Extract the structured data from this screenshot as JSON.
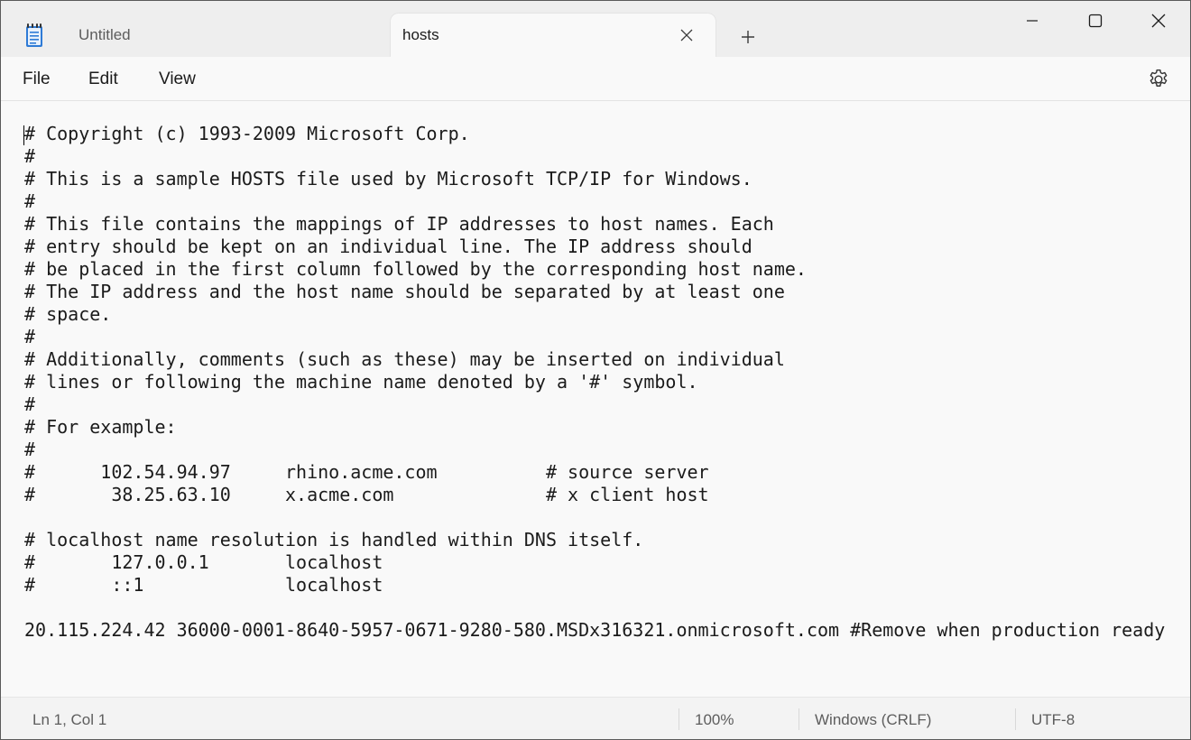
{
  "tabs": [
    {
      "label": "Untitled",
      "active": false
    },
    {
      "label": "hosts",
      "active": true
    }
  ],
  "icons": {
    "app": "notepad-icon",
    "tab_close": "close-icon",
    "new_tab": "plus-icon",
    "minimize": "minimize-icon",
    "maximize": "maximize-icon",
    "close": "close-icon",
    "settings": "gear-icon"
  },
  "menu": {
    "file": "File",
    "edit": "Edit",
    "view": "View"
  },
  "editor": {
    "content": "# Copyright (c) 1993-2009 Microsoft Corp.\n#\n# This is a sample HOSTS file used by Microsoft TCP/IP for Windows.\n#\n# This file contains the mappings of IP addresses to host names. Each\n# entry should be kept on an individual line. The IP address should\n# be placed in the first column followed by the corresponding host name.\n# The IP address and the host name should be separated by at least one\n# space.\n#\n# Additionally, comments (such as these) may be inserted on individual\n# lines or following the machine name denoted by a '#' symbol.\n#\n# For example:\n#\n#      102.54.94.97     rhino.acme.com          # source server\n#       38.25.63.10     x.acme.com              # x client host\n\n# localhost name resolution is handled within DNS itself.\n#       127.0.0.1       localhost\n#       ::1             localhost\n\n20.115.224.42 36000-0001-8640-5957-0671-9280-580.MSDx316321.onmicrosoft.com #Remove when production ready"
  },
  "status": {
    "position": "Ln 1, Col 1",
    "zoom": "100%",
    "line_endings": "Windows (CRLF)",
    "encoding": "UTF-8"
  },
  "colors": {
    "accent": "#1e66c8",
    "text": "#1b1b1b",
    "muted": "#5d5d5d"
  }
}
